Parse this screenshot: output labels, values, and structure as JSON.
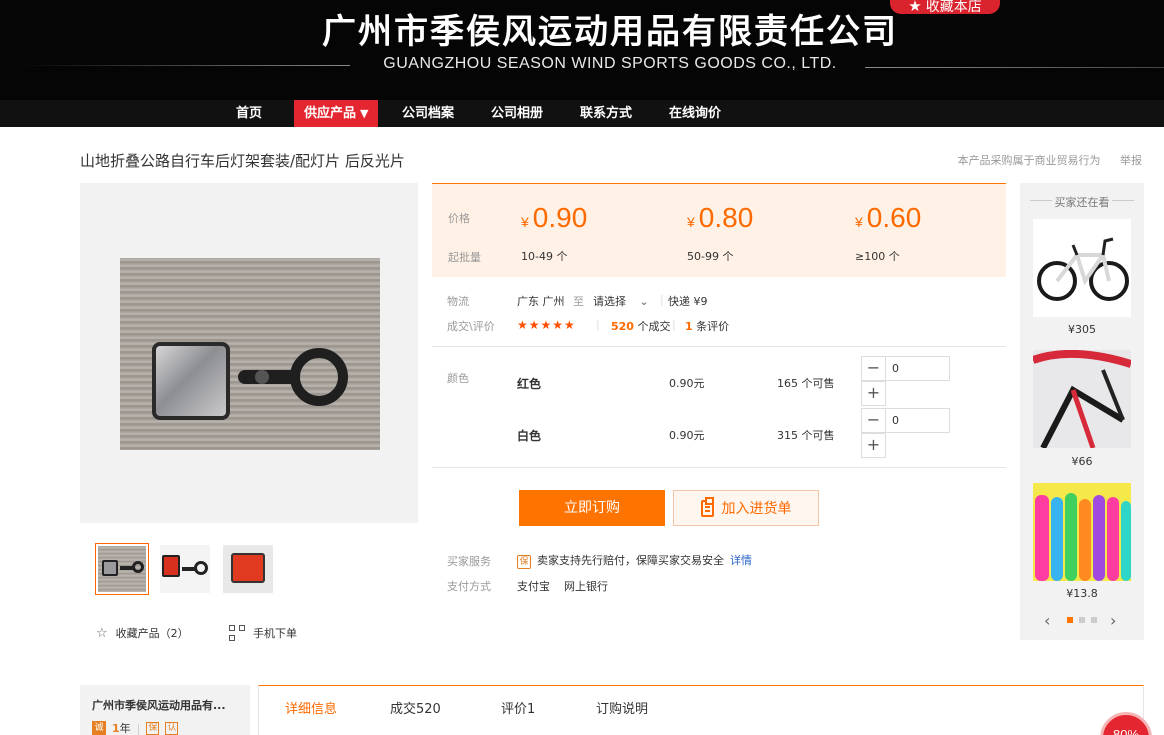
{
  "header": {
    "company_cn": "广州市季侯风运动用品有限责任公司",
    "company_en": "GUANGZHOU SEASON WIND SPORTS GOODS CO., LTD.",
    "favorite_store_label": "收藏本店"
  },
  "nav": {
    "items": [
      {
        "label": "首页"
      },
      {
        "label": "供应产品"
      },
      {
        "label": "公司档案"
      },
      {
        "label": "公司相册"
      },
      {
        "label": "联系方式"
      },
      {
        "label": "在线询价"
      }
    ],
    "active_arrow": "▼"
  },
  "product": {
    "title": "山地折叠公路自行车后灯架套装/配灯片 后反光片",
    "note": "本产品采购属于商业贸易行为",
    "report_label": "举报"
  },
  "pricing": {
    "price_label": "价格",
    "moq_label": "起批量",
    "currency": "¥",
    "tiers": [
      {
        "price": "0.90",
        "qty": "10-49 个"
      },
      {
        "price": "0.80",
        "qty": "50-99 个"
      },
      {
        "price": "0.60",
        "qty": "≥100 个"
      }
    ]
  },
  "logistics": {
    "label": "物流",
    "from": "广东 广州",
    "to_label": "至",
    "select_placeholder": "请选择",
    "shipping": "快递 ¥9"
  },
  "reviews": {
    "label": "成交\\评价",
    "stars": "★★★★★",
    "deals_count": "520",
    "deals_suffix": "个成交",
    "review_count": "1",
    "review_suffix": "条评价"
  },
  "color": {
    "label": "颜色",
    "options": [
      {
        "name": "红色",
        "price": "0.90元",
        "available": "165 个可售",
        "qty": "0"
      },
      {
        "name": "白色",
        "price": "0.90元",
        "available": "315 个可售",
        "qty": "0"
      }
    ],
    "minus": "−",
    "plus": "+"
  },
  "actions": {
    "buy_now": "立即订购",
    "add_to_list": "加入进货单"
  },
  "service": {
    "buyer_label": "买家服务",
    "guarantee_icon": "保",
    "guarantee_text": "卖家支持先行赔付，保障买家交易安全",
    "details_link": "详情",
    "payment_label": "支付方式",
    "payment_methods": "支付宝    网上银行"
  },
  "gallery": {
    "collect_label": "收藏产品（2）",
    "mobile_order_label": "手机下单"
  },
  "sidebar": {
    "title": "买家还在看",
    "items": [
      {
        "price": "¥305"
      },
      {
        "price": "¥66"
      },
      {
        "price": "¥13.8"
      }
    ],
    "prev": "‹",
    "next": "›"
  },
  "shop": {
    "name": "广州市季侯风运动用品有...",
    "years_icon": "诚",
    "years": "1",
    "years_suffix": "年",
    "badge1": "保",
    "badge2": "认"
  },
  "tabs": [
    {
      "label": "详细信息"
    },
    {
      "label": "成交520"
    },
    {
      "label": "评价1"
    },
    {
      "label": "订购说明"
    }
  ],
  "floating_badge": "80%",
  "colors": {
    "accent": "#ff7300",
    "nav_active": "#e3262f",
    "price_bg": "#fff1e6"
  }
}
